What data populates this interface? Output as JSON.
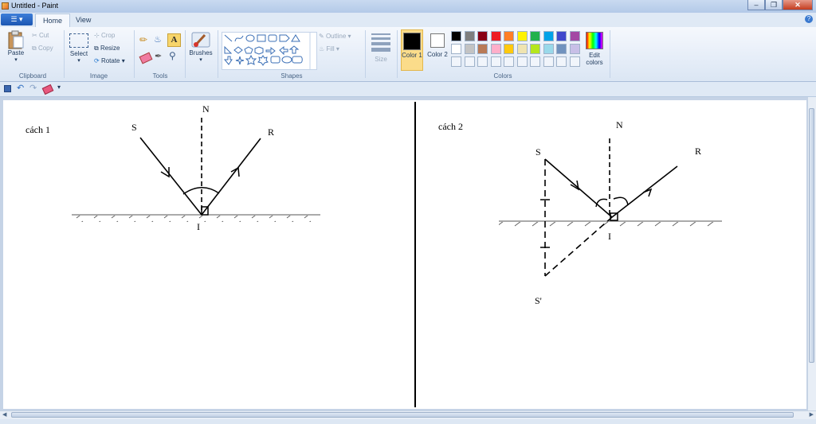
{
  "window": {
    "title": "Untitled - Paint"
  },
  "tabs": [
    {
      "label": "Home"
    },
    {
      "label": "View"
    }
  ],
  "clipboard": {
    "paste": "Paste",
    "cut": "Cut",
    "copy": "Copy",
    "group": "Clipboard"
  },
  "image": {
    "select": "Select",
    "crop": "Crop",
    "resize": "Resize",
    "rotate": "Rotate",
    "group": "Image"
  },
  "tools": {
    "group": "Tools"
  },
  "brushes": {
    "label": "Brushes"
  },
  "shapes": {
    "outline": "Outline",
    "fill": "Fill",
    "group": "Shapes"
  },
  "size": {
    "label": "Size"
  },
  "colors": {
    "color1": "Color 1",
    "color2": "Color 2",
    "edit": "Edit colors",
    "group": "Colors",
    "color1_value": "#000000",
    "color2_value": "#ffffff",
    "palette_row1": [
      "#000000",
      "#7f7f7f",
      "#880015",
      "#ed1c24",
      "#ff7f27",
      "#fff200",
      "#22b14c",
      "#00a2e8",
      "#3f48cc",
      "#a349a4"
    ],
    "palette_row2": [
      "#ffffff",
      "#c3c3c3",
      "#b97a57",
      "#ffaec9",
      "#ffc90e",
      "#efe4b0",
      "#b5e61d",
      "#99d9ea",
      "#7092be",
      "#c8bfe7"
    ]
  },
  "drawing": {
    "left": {
      "caption": "cách 1",
      "S": "S",
      "N": "N",
      "R": "R",
      "I": "I"
    },
    "right": {
      "caption": "cách 2",
      "S": "S",
      "N": "N",
      "R": "R",
      "I": "I",
      "S_prime": "S'"
    }
  }
}
